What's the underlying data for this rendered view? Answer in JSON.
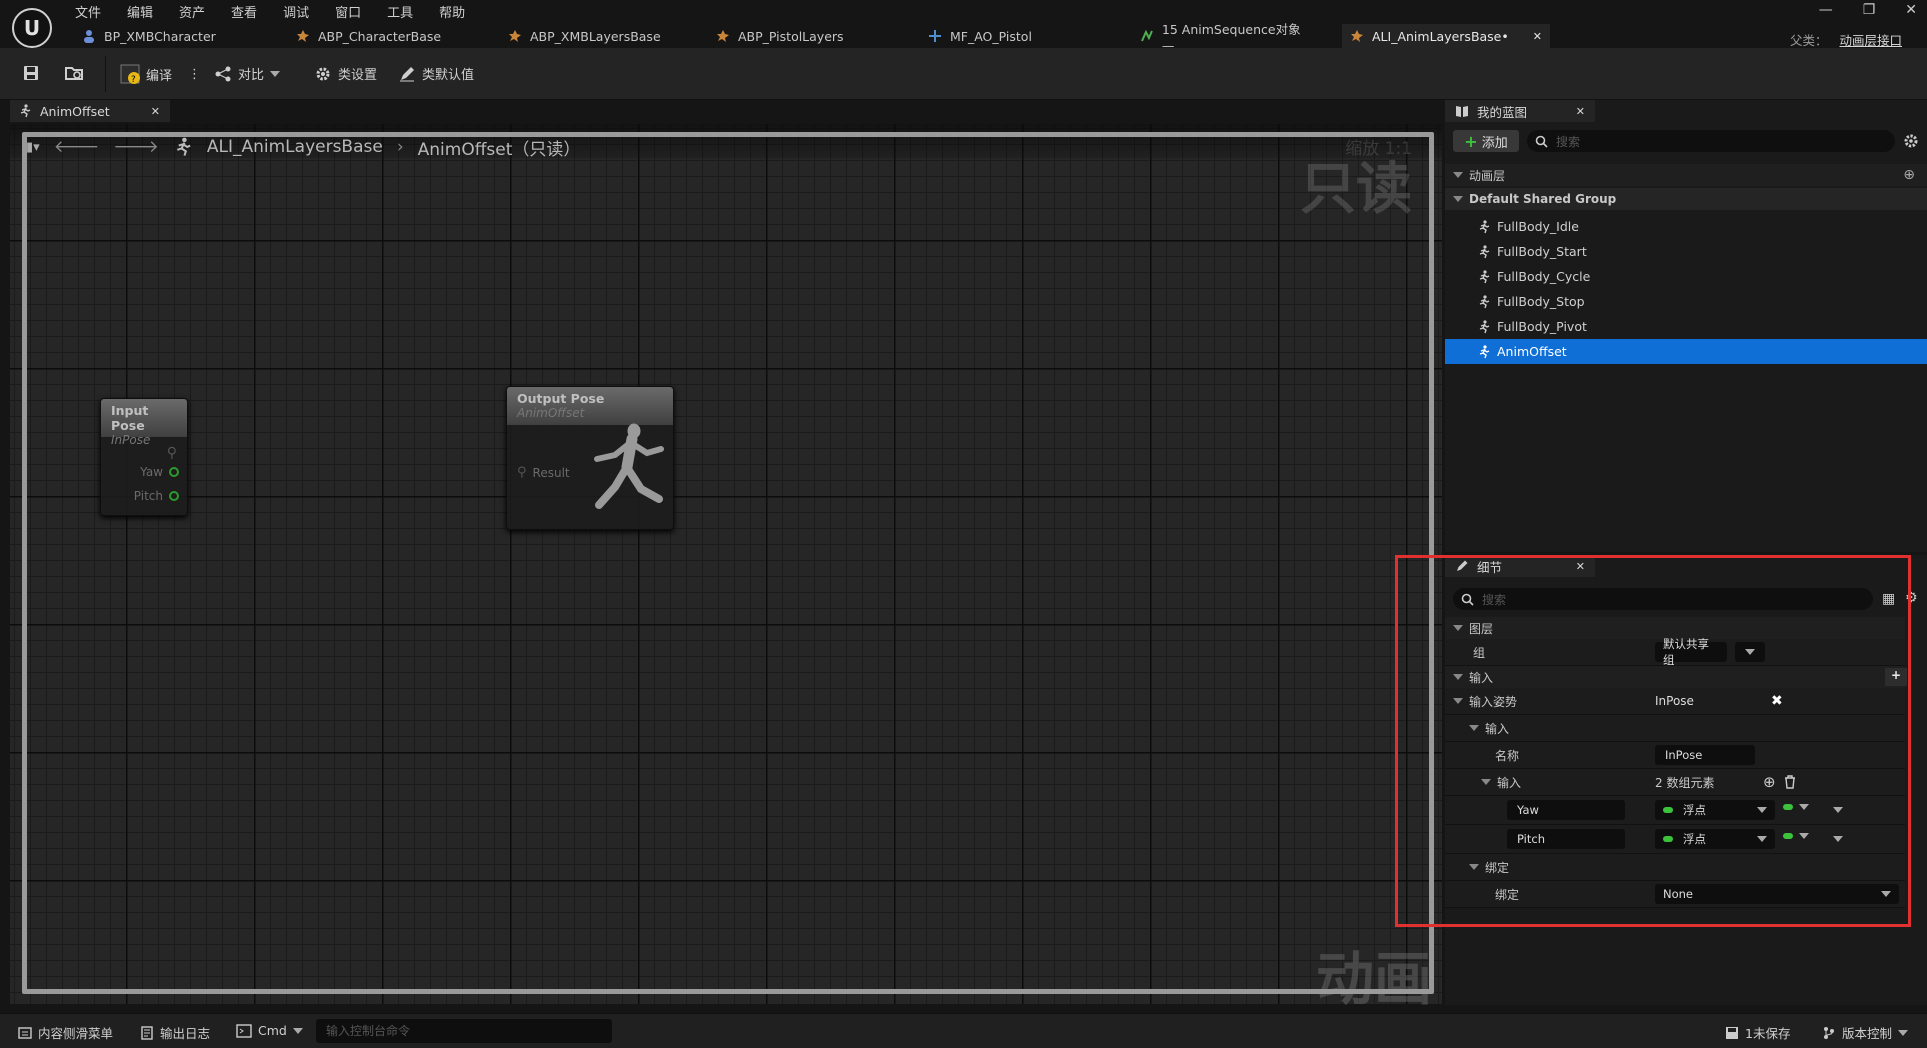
{
  "menu": [
    "文件",
    "编辑",
    "资产",
    "查看",
    "调试",
    "窗口",
    "工具",
    "帮助"
  ],
  "asset_tabs": [
    {
      "label": "BP_XMBCharacter",
      "icon": "character-icon"
    },
    {
      "label": "ABP_CharacterBase",
      "icon": "anim-blueprint-icon"
    },
    {
      "label": "ABP_XMBLayersBase",
      "icon": "anim-blueprint-icon"
    },
    {
      "label": "ABP_PistolLayers",
      "icon": "anim-blueprint-icon"
    },
    {
      "label": "MF_AO_Pistol",
      "icon": "material-function-icon"
    },
    {
      "label": "15 AnimSequence对象—...",
      "icon": "anim-sequence-icon"
    },
    {
      "label": "ALI_AnimLayersBase•",
      "icon": "anim-layer-interface-icon"
    }
  ],
  "parent": {
    "label": "父类：",
    "value": "动画层接口"
  },
  "toolbar": {
    "compile": "编译",
    "diff": "对比",
    "class_settings": "类设置",
    "class_defaults": "类默认值"
  },
  "doc_tab": {
    "label": "AnimOffset"
  },
  "graph": {
    "crumb_root": "ALI_AnimLayersBase",
    "crumb_current": "AnimOffset（只读）",
    "zoom": "缩放 1:1",
    "readonly_watermark": "只读",
    "anim_watermark": "动画",
    "input_node": {
      "title": "Input Pose",
      "subtitle": "InPose",
      "pins": [
        "Yaw",
        "Pitch"
      ]
    },
    "output_node": {
      "title": "Output Pose",
      "subtitle": "AnimOffset",
      "pin": "Result"
    }
  },
  "my_blueprint": {
    "tab": "我的蓝图",
    "add": "添加",
    "search_placeholder": "搜索",
    "section": "动画层",
    "group": "Default Shared Group",
    "items": [
      "FullBody_Idle",
      "FullBody_Start",
      "FullBody_Cycle",
      "FullBody_Stop",
      "FullBody_Pivot",
      "AnimOffset"
    ],
    "selected_index": 5
  },
  "details": {
    "tab": "细节",
    "search_placeholder": "搜索",
    "sec_layer": "图层",
    "group_label": "组",
    "group_value": "默认共享组",
    "sec_inputs": "输入",
    "input_pose_label": "输入姿势",
    "input_pose_value": "InPose",
    "input_sub": "输入",
    "name_label": "名称",
    "name_value": "InPose",
    "inputs_label": "输入",
    "inputs_count": "2 数组元素",
    "params": [
      {
        "name": "Yaw",
        "type": "浮点"
      },
      {
        "name": "Pitch",
        "type": "浮点"
      }
    ],
    "binding_sec": "绑定",
    "binding_label": "绑定",
    "binding_value": "None"
  },
  "statusbar": {
    "content_drawer": "内容侧滑菜单",
    "output_log": "输出日志",
    "cmd": "Cmd",
    "cmd_placeholder": "输入控制台命令",
    "unsaved": "1未保存",
    "source_control": "版本控制"
  },
  "colors": {
    "selection": "#0f6fd6",
    "highlight_box": "#e03030",
    "float_pin": "#3cc33c"
  }
}
